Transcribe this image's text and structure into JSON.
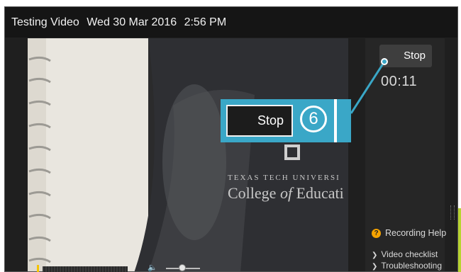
{
  "window": {
    "title": "Testing Video",
    "date": "Wed 30 Mar 2016",
    "time": "2:56 PM"
  },
  "video": {
    "overlay_line1": "TEXAS TECH UNIVERSI",
    "overlay_line2_a": "College ",
    "overlay_line2_b": "of",
    "overlay_line2_c": " Educati"
  },
  "side_panel": {
    "stop_label": "Stop",
    "timer": "00:11",
    "help_label": "Recording Help",
    "help_icon_glyph": "?",
    "links": [
      {
        "label": "Video checklist"
      },
      {
        "label": "Troubleshooting"
      }
    ]
  },
  "callout": {
    "stop_label": "Stop",
    "step_number": "6",
    "color": "#3aa7c7"
  },
  "player": {
    "volume_icon": "speaker-icon",
    "volume_level": 0.45,
    "progress_color": "#f5c400"
  }
}
